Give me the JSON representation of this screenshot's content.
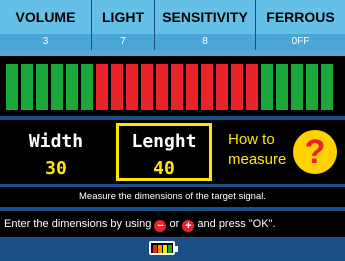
{
  "header": {
    "columns": [
      {
        "name": "VOLUME",
        "value": "3"
      },
      {
        "name": "LIGHT",
        "value": "7"
      },
      {
        "name": "SENSITIVITY",
        "value": "8"
      },
      {
        "name": "FERROUS",
        "value": "0FF"
      }
    ]
  },
  "signal_bars": {
    "colors": {
      "green": "#1ba83a",
      "red": "#e8232a"
    },
    "pattern": [
      "green",
      "green",
      "green",
      "green",
      "green",
      "green",
      "red",
      "red",
      "red",
      "red",
      "red",
      "red",
      "red",
      "red",
      "red",
      "red",
      "red",
      "green",
      "green",
      "green",
      "green",
      "green"
    ]
  },
  "dimensions": {
    "width": {
      "label": "Width",
      "value": "30"
    },
    "length": {
      "label": "Lenght",
      "value": "40"
    },
    "how_to": {
      "line1": "How to",
      "line2": "measure",
      "icon": "question-icon",
      "glyph": "?"
    }
  },
  "messages": {
    "line1": "Measure the dimensions of the target signal.",
    "line2_prefix": "Enter the dimensions by using",
    "minus_glyph": "−",
    "line2_or": "or",
    "plus_glyph": "+",
    "line2_suffix": "and press \"OK\"."
  },
  "battery": {
    "icon": "battery-icon",
    "level_segments": 4,
    "colors": [
      "#e8232a",
      "#ff9a00",
      "#ffe600",
      "#1ba83a"
    ]
  }
}
